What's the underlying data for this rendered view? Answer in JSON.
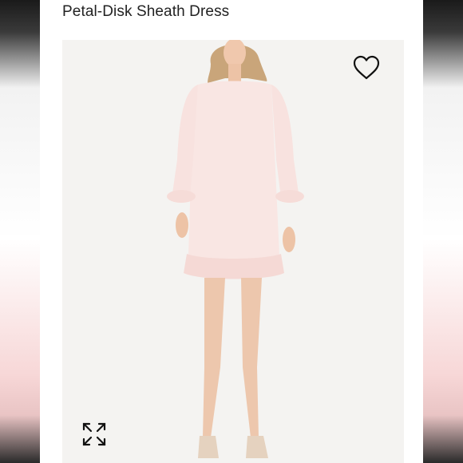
{
  "product": {
    "title": "Petal-Disk Sheath Dress"
  },
  "image": {
    "alt": "Model wearing a light pink long-sleeve sheath dress with ruffled hem"
  },
  "icons": {
    "favorite": "heart-icon",
    "expand": "expand-icon"
  },
  "colors": {
    "background": "#ffffff",
    "photo_background": "#f4f3f1",
    "dress": "#f9e6e3",
    "text": "#222222"
  }
}
